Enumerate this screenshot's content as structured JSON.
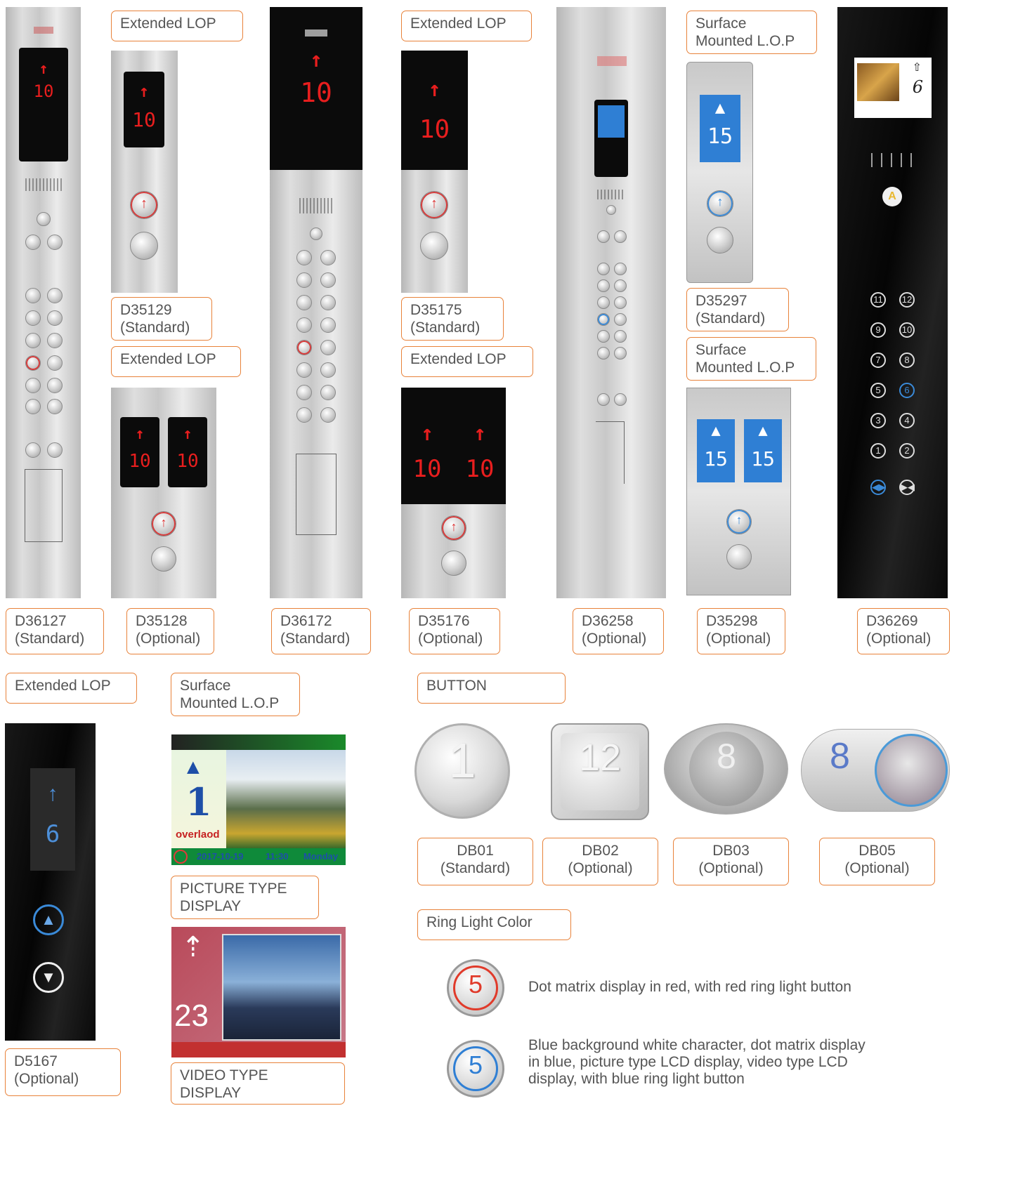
{
  "panels": {
    "d36127": {
      "floor": "10",
      "arrow": "↑",
      "code": "D36127\n(Standard)"
    },
    "d35129": {
      "header": "Extended LOP",
      "floor": "10",
      "arrow": "↑",
      "code": "D35129\n(Standard)"
    },
    "d35128": {
      "header": "Extended LOP",
      "floor": "10",
      "arrow": "↑",
      "code": "D35128\n(Optional)"
    },
    "d36172": {
      "floor": "10",
      "arrow": "↑",
      "code": "D36172\n(Standard)"
    },
    "d35175": {
      "header": "Extended LOP",
      "floor": "10",
      "arrow": "↑",
      "code": "D35175\n(Standard)"
    },
    "d35176": {
      "header": "Extended LOP",
      "floor": "10",
      "arrow": "↑",
      "code": "D35176\n(Optional)"
    },
    "d36258": {
      "code": "D36258\n(Optional)"
    },
    "d35297": {
      "header": "Surface\nMounted L.O.P",
      "floor": "15",
      "code": "D35297\n(Standard)"
    },
    "d35298": {
      "header": "Surface\nMounted L.O.P",
      "floor": "15",
      "code": "D35298\n(Optional)"
    },
    "d36269": {
      "floor": "6",
      "code": "D36269\n(Optional)",
      "keys": [
        "11",
        "12",
        "9",
        "10",
        "7",
        "8",
        "5",
        "6",
        "3",
        "4",
        "1",
        "2"
      ]
    },
    "d5167": {
      "header": "Extended LOP",
      "code": "D5167\n(Optional)"
    }
  },
  "display_section": {
    "header": "Surface\nMounted L.O.P",
    "picture": {
      "floor": "1",
      "status": "overlaod",
      "date": "2017-10-19",
      "time": "11:30",
      "day": "Monday",
      "caption": "PICTURE TYPE\nDISPLAY"
    },
    "video": {
      "floor": "23",
      "caption": "VIDEO TYPE\nDISPLAY"
    }
  },
  "buttons_section": {
    "header": "BUTTON",
    "items": [
      {
        "glyph": "1",
        "code": "DB01\n(Standard)"
      },
      {
        "glyph": "12",
        "code": "DB02\n(Optional)"
      },
      {
        "glyph": "8",
        "code": "DB03\n(Optional)"
      },
      {
        "glyph": "8",
        "code": "DB05\n(Optional)"
      }
    ]
  },
  "ring_section": {
    "header": "Ring Light Color",
    "red": {
      "glyph": "5",
      "desc": "Dot matrix display in red, with red ring light button",
      "color": "#e03a2a"
    },
    "blue": {
      "glyph": "5",
      "desc": "Blue background white character, dot matrix display\nin blue, picture type LCD display, video type LCD\ndisplay, with blue ring light button",
      "color": "#2f7fd4"
    }
  }
}
